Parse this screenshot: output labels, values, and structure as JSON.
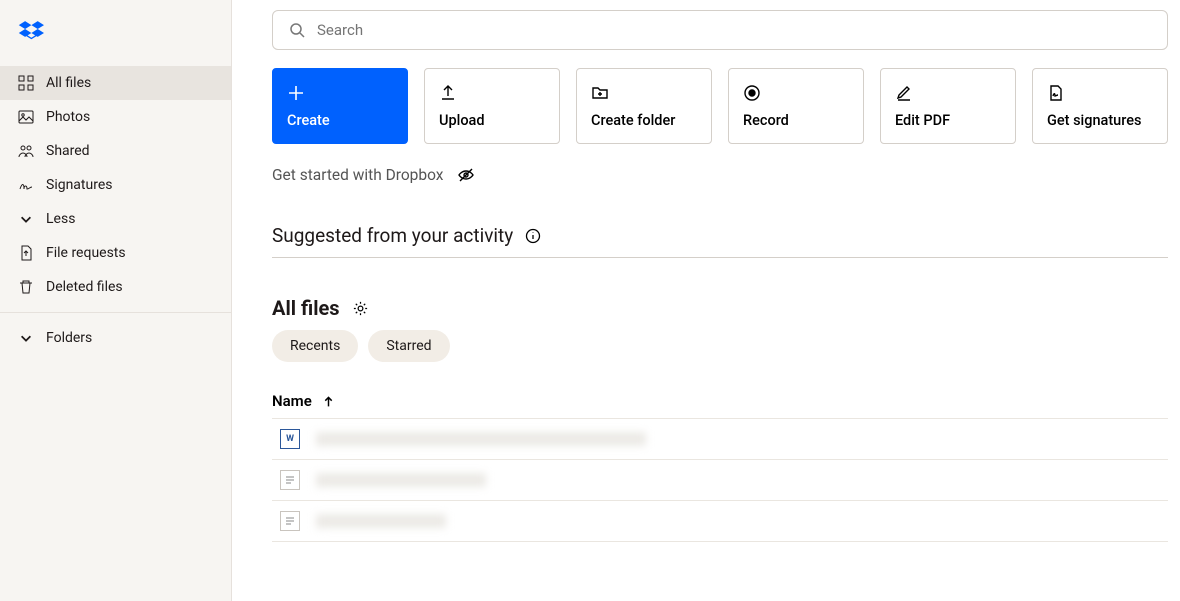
{
  "search": {
    "placeholder": "Search"
  },
  "sidebar": {
    "items": [
      {
        "label": "All files"
      },
      {
        "label": "Photos"
      },
      {
        "label": "Shared"
      },
      {
        "label": "Signatures"
      },
      {
        "label": "Less"
      },
      {
        "label": "File requests"
      },
      {
        "label": "Deleted files"
      }
    ],
    "folders_label": "Folders"
  },
  "actions": {
    "create": "Create",
    "upload": "Upload",
    "create_folder": "Create folder",
    "record": "Record",
    "edit_pdf": "Edit PDF",
    "get_signatures": "Get signatures"
  },
  "get_started": "Get started with Dropbox",
  "suggested_title": "Suggested from your activity",
  "all_files_title": "All files",
  "chips": {
    "recents": "Recents",
    "starred": "Starred"
  },
  "columns": {
    "name": "Name"
  },
  "files": [
    {
      "type": "word"
    },
    {
      "type": "doc"
    },
    {
      "type": "doc"
    }
  ]
}
